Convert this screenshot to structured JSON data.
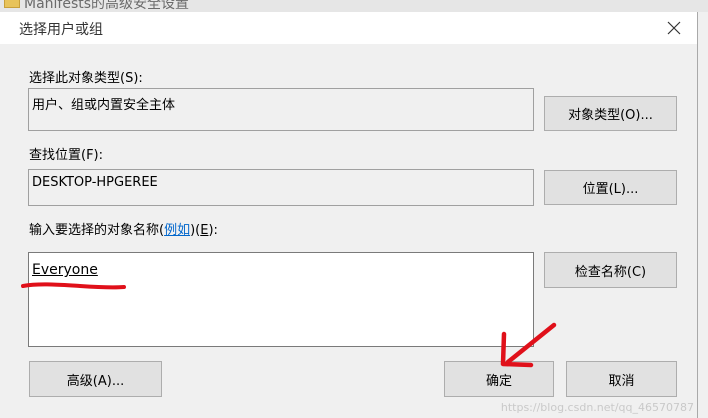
{
  "background_window": {
    "title": "Manifests的高级安全设置"
  },
  "dialog": {
    "title": "选择用户或组",
    "close_glyph": "✕",
    "object_type": {
      "label": "选择此对象类型(S):",
      "value": "用户、组或内置安全主体",
      "button": "对象类型(O)..."
    },
    "location": {
      "label": "查找位置(F):",
      "value": "DESKTOP-HPGEREE",
      "button": "位置(L)..."
    },
    "names": {
      "label_prefix": "输入要选择的对象名称(",
      "label_link": "例如",
      "label_mid": ")(",
      "label_key": "E",
      "label_suffix": "):",
      "value": "Everyone",
      "check_button": "检查名称(C)"
    },
    "advanced_button": "高级(A)...",
    "ok_button": "确定",
    "cancel_button": "取消"
  },
  "watermark": "https://blog.csdn.net/qq_46570787",
  "colors": {
    "annotation": "#e0101a",
    "link": "#0066cc"
  }
}
